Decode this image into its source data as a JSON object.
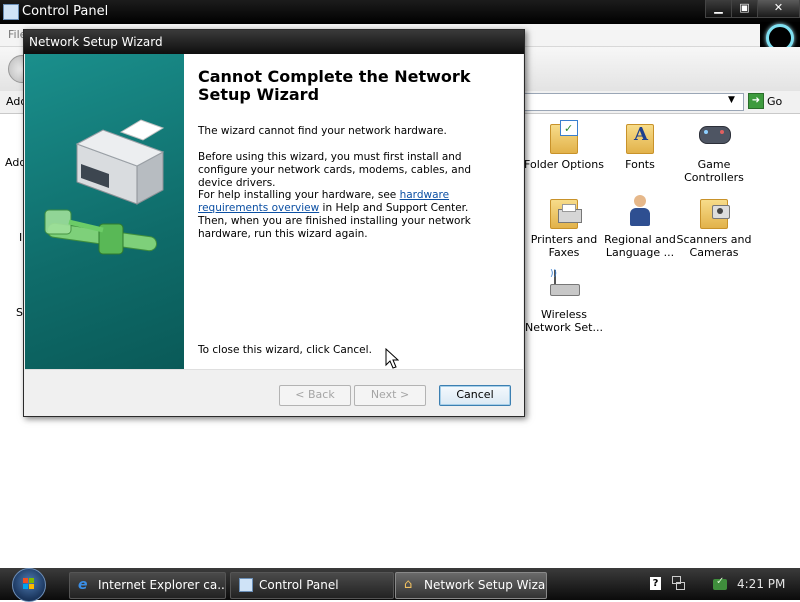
{
  "control_panel": {
    "title": "Control Panel",
    "menu_text": "File",
    "address_label": "Add",
    "go_label": "Go",
    "left_fragments": [
      "Add",
      "I",
      "S"
    ],
    "items": [
      {
        "label": "Folder Options",
        "icon": "folder-options-icon"
      },
      {
        "label": "Fonts",
        "icon": "fonts-icon"
      },
      {
        "label": "Game Controllers",
        "icon": "game-controllers-icon"
      },
      {
        "label": "Printers and Faxes",
        "icon": "printers-icon"
      },
      {
        "label": "Regional and Language ...",
        "icon": "regional-icon"
      },
      {
        "label": "Scanners and Cameras",
        "icon": "scanners-icon"
      },
      {
        "label": "Wireless Network Set...",
        "icon": "wireless-icon"
      }
    ]
  },
  "wizard": {
    "title": "Network Setup Wizard",
    "heading": "Cannot Complete the Network Setup Wizard",
    "p1": "The wizard cannot find your network hardware.",
    "p2": "Before using this wizard, you must first install and configure your network cards, modems, cables, and device drivers.",
    "p3_before": "For help installing your hardware, see ",
    "p3_link": "hardware requirements overview",
    "p3_after": " in Help and Support Center. Then, when you are finished installing your network hardware, run this wizard again.",
    "close_text": "To close this wizard, click Cancel.",
    "buttons": {
      "back": "< Back",
      "next": "Next >",
      "cancel": "Cancel"
    }
  },
  "taskbar": {
    "tasks": [
      {
        "label": "Internet Explorer ca..."
      },
      {
        "label": "Control Panel"
      },
      {
        "label": "Network Setup Wizard"
      }
    ],
    "clock": "4:21 PM"
  }
}
